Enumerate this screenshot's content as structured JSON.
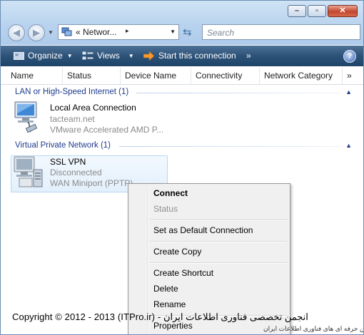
{
  "window": {
    "caption_buttons": [
      "minimize",
      "maximize",
      "close"
    ]
  },
  "nav": {
    "address_text": "Networ...",
    "address_prefix": "«",
    "address_arrow": "▸",
    "search_placeholder": "Search"
  },
  "toolbar": {
    "organize": "Organize",
    "views": "Views",
    "start_connection": "Start this connection",
    "more": "»",
    "help": "?"
  },
  "columns": [
    "Name",
    "Status",
    "Device Name",
    "Connectivity",
    "Network Category",
    "»"
  ],
  "groups": [
    {
      "label": "LAN or High-Speed Internet (1)",
      "items": [
        {
          "name": "Local Area Connection",
          "line2": "tacteam.net",
          "line3": "VMware Accelerated AMD P..."
        }
      ]
    },
    {
      "label": "Virtual Private Network (1)",
      "items": [
        {
          "name": "SSL VPN",
          "line2": "Disconnected",
          "line3": "WAN Miniport (PPTP)"
        }
      ]
    }
  ],
  "context_menu": {
    "items": [
      {
        "label": "Connect",
        "style": "bold"
      },
      {
        "label": "Status",
        "style": "disabled"
      },
      {
        "label": "Set as Default Connection",
        "style": "normal"
      },
      {
        "label": "Create Copy",
        "style": "normal"
      },
      {
        "label": "Create Shortcut",
        "style": "normal"
      },
      {
        "label": "Delete",
        "style": "normal"
      },
      {
        "label": "Rename",
        "style": "normal"
      },
      {
        "label": "Properties",
        "style": "normal"
      }
    ]
  },
  "watermark": {
    "copyright": "Copyright © 2012 - 2013 (ITPro.ir) - انجمن تخصصی فناوری اطلاعات ایران",
    "logo": "ITPro.ir",
    "tagline": "انجمن حرفه ای های فناوری اطلاعات ایران"
  },
  "colors": {
    "toolbar_bg": "#2d5278",
    "group_header": "#1f3d8f",
    "selection": "#e3f0fc"
  }
}
